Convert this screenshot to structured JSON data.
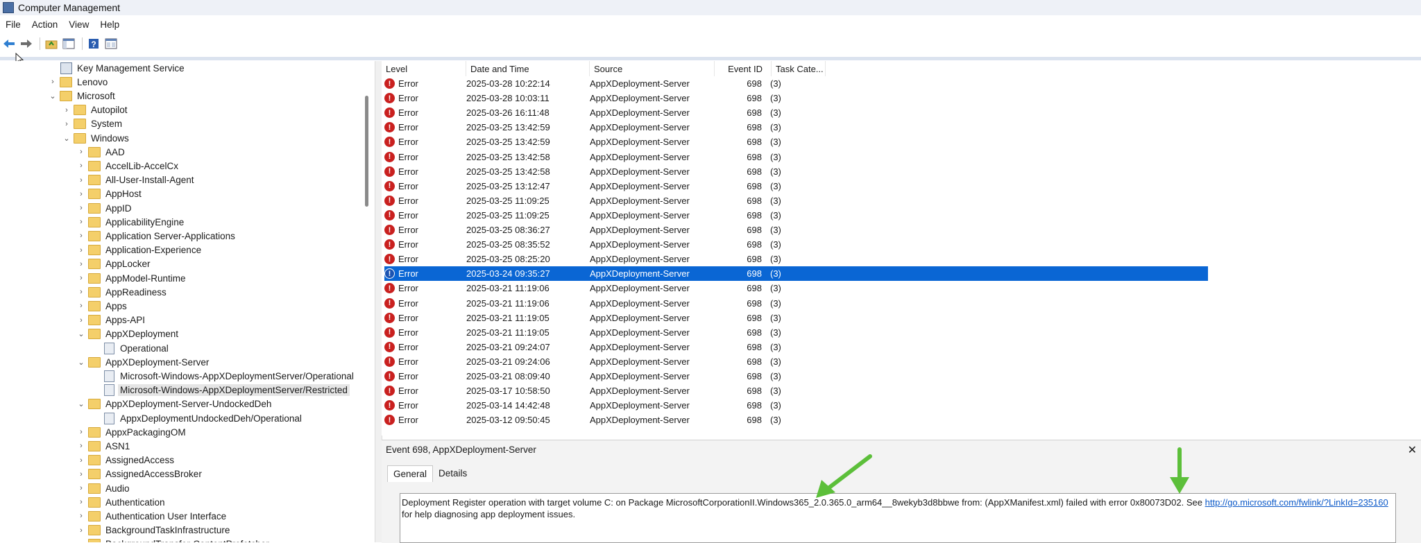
{
  "window": {
    "title": "Computer Management"
  },
  "menu": [
    "File",
    "Action",
    "View",
    "Help"
  ],
  "tree": {
    "items": [
      {
        "label": "Key Management Service",
        "depth": 0,
        "type": "key",
        "expander": ""
      },
      {
        "label": "Lenovo",
        "depth": 0,
        "type": "folder",
        "expander": "›"
      },
      {
        "label": "Microsoft",
        "depth": 0,
        "type": "folder",
        "expander": "⌄"
      },
      {
        "label": "Autopilot",
        "depth": 1,
        "type": "folder",
        "expander": "›"
      },
      {
        "label": "System",
        "depth": 1,
        "type": "folder",
        "expander": "›"
      },
      {
        "label": "Windows",
        "depth": 1,
        "type": "folder",
        "expander": "⌄"
      },
      {
        "label": "AAD",
        "depth": 2,
        "type": "folder",
        "expander": "›"
      },
      {
        "label": "AccelLib-AccelCx",
        "depth": 2,
        "type": "folder",
        "expander": "›"
      },
      {
        "label": "All-User-Install-Agent",
        "depth": 2,
        "type": "folder",
        "expander": "›"
      },
      {
        "label": "AppHost",
        "depth": 2,
        "type": "folder",
        "expander": "›"
      },
      {
        "label": "AppID",
        "depth": 2,
        "type": "folder",
        "expander": "›"
      },
      {
        "label": "ApplicabilityEngine",
        "depth": 2,
        "type": "folder",
        "expander": "›"
      },
      {
        "label": "Application Server-Applications",
        "depth": 2,
        "type": "folder",
        "expander": "›"
      },
      {
        "label": "Application-Experience",
        "depth": 2,
        "type": "folder",
        "expander": "›"
      },
      {
        "label": "AppLocker",
        "depth": 2,
        "type": "folder",
        "expander": "›"
      },
      {
        "label": "AppModel-Runtime",
        "depth": 2,
        "type": "folder",
        "expander": "›"
      },
      {
        "label": "AppReadiness",
        "depth": 2,
        "type": "folder",
        "expander": "›"
      },
      {
        "label": "Apps",
        "depth": 2,
        "type": "folder",
        "expander": "›"
      },
      {
        "label": "Apps-API",
        "depth": 2,
        "type": "folder",
        "expander": "›"
      },
      {
        "label": "AppXDeployment",
        "depth": 2,
        "type": "folder",
        "expander": "⌄"
      },
      {
        "label": "Operational",
        "depth": 3,
        "type": "log",
        "expander": ""
      },
      {
        "label": "AppXDeployment-Server",
        "depth": 2,
        "type": "folder",
        "expander": "⌄"
      },
      {
        "label": "Microsoft-Windows-AppXDeploymentServer/Operational",
        "depth": 3,
        "type": "log",
        "expander": ""
      },
      {
        "label": "Microsoft-Windows-AppXDeploymentServer/Restricted",
        "depth": 3,
        "type": "log",
        "expander": "",
        "selected": true
      },
      {
        "label": "AppXDeployment-Server-UndockedDeh",
        "depth": 2,
        "type": "folder",
        "expander": "⌄"
      },
      {
        "label": "AppxDeploymentUndockedDeh/Operational",
        "depth": 3,
        "type": "log",
        "expander": ""
      },
      {
        "label": "AppxPackagingOM",
        "depth": 2,
        "type": "folder",
        "expander": "›"
      },
      {
        "label": "ASN1",
        "depth": 2,
        "type": "folder",
        "expander": "›"
      },
      {
        "label": "AssignedAccess",
        "depth": 2,
        "type": "folder",
        "expander": "›"
      },
      {
        "label": "AssignedAccessBroker",
        "depth": 2,
        "type": "folder",
        "expander": "›"
      },
      {
        "label": "Audio",
        "depth": 2,
        "type": "folder",
        "expander": "›"
      },
      {
        "label": "Authentication",
        "depth": 2,
        "type": "folder",
        "expander": "›"
      },
      {
        "label": "Authentication User Interface",
        "depth": 2,
        "type": "folder",
        "expander": "›"
      },
      {
        "label": "BackgroundTaskInfrastructure",
        "depth": 2,
        "type": "folder",
        "expander": "›"
      },
      {
        "label": "BackgroundTransfer-ContentPrefetcher",
        "depth": 2,
        "type": "folder",
        "expander": "›"
      }
    ]
  },
  "events": {
    "columns": [
      "Level",
      "Date and Time",
      "Source",
      "Event ID",
      "Task Cate..."
    ],
    "rows": [
      {
        "level": "Error",
        "datetime": "2025-03-28 10:22:14",
        "source": "AppXDeployment-Server",
        "id": "698",
        "task": "(3)"
      },
      {
        "level": "Error",
        "datetime": "2025-03-28 10:03:11",
        "source": "AppXDeployment-Server",
        "id": "698",
        "task": "(3)"
      },
      {
        "level": "Error",
        "datetime": "2025-03-26 16:11:48",
        "source": "AppXDeployment-Server",
        "id": "698",
        "task": "(3)"
      },
      {
        "level": "Error",
        "datetime": "2025-03-25 13:42:59",
        "source": "AppXDeployment-Server",
        "id": "698",
        "task": "(3)"
      },
      {
        "level": "Error",
        "datetime": "2025-03-25 13:42:59",
        "source": "AppXDeployment-Server",
        "id": "698",
        "task": "(3)"
      },
      {
        "level": "Error",
        "datetime": "2025-03-25 13:42:58",
        "source": "AppXDeployment-Server",
        "id": "698",
        "task": "(3)"
      },
      {
        "level": "Error",
        "datetime": "2025-03-25 13:42:58",
        "source": "AppXDeployment-Server",
        "id": "698",
        "task": "(3)"
      },
      {
        "level": "Error",
        "datetime": "2025-03-25 13:12:47",
        "source": "AppXDeployment-Server",
        "id": "698",
        "task": "(3)"
      },
      {
        "level": "Error",
        "datetime": "2025-03-25 11:09:25",
        "source": "AppXDeployment-Server",
        "id": "698",
        "task": "(3)"
      },
      {
        "level": "Error",
        "datetime": "2025-03-25 11:09:25",
        "source": "AppXDeployment-Server",
        "id": "698",
        "task": "(3)"
      },
      {
        "level": "Error",
        "datetime": "2025-03-25 08:36:27",
        "source": "AppXDeployment-Server",
        "id": "698",
        "task": "(3)"
      },
      {
        "level": "Error",
        "datetime": "2025-03-25 08:35:52",
        "source": "AppXDeployment-Server",
        "id": "698",
        "task": "(3)"
      },
      {
        "level": "Error",
        "datetime": "2025-03-25 08:25:20",
        "source": "AppXDeployment-Server",
        "id": "698",
        "task": "(3)"
      },
      {
        "level": "Error",
        "datetime": "2025-03-24 09:35:27",
        "source": "AppXDeployment-Server",
        "id": "698",
        "task": "(3)",
        "selected": true
      },
      {
        "level": "Error",
        "datetime": "2025-03-21 11:19:06",
        "source": "AppXDeployment-Server",
        "id": "698",
        "task": "(3)"
      },
      {
        "level": "Error",
        "datetime": "2025-03-21 11:19:06",
        "source": "AppXDeployment-Server",
        "id": "698",
        "task": "(3)"
      },
      {
        "level": "Error",
        "datetime": "2025-03-21 11:19:05",
        "source": "AppXDeployment-Server",
        "id": "698",
        "task": "(3)"
      },
      {
        "level": "Error",
        "datetime": "2025-03-21 11:19:05",
        "source": "AppXDeployment-Server",
        "id": "698",
        "task": "(3)"
      },
      {
        "level": "Error",
        "datetime": "2025-03-21 09:24:07",
        "source": "AppXDeployment-Server",
        "id": "698",
        "task": "(3)"
      },
      {
        "level": "Error",
        "datetime": "2025-03-21 09:24:06",
        "source": "AppXDeployment-Server",
        "id": "698",
        "task": "(3)"
      },
      {
        "level": "Error",
        "datetime": "2025-03-21 08:09:40",
        "source": "AppXDeployment-Server",
        "id": "698",
        "task": "(3)"
      },
      {
        "level": "Error",
        "datetime": "2025-03-17 10:58:50",
        "source": "AppXDeployment-Server",
        "id": "698",
        "task": "(3)"
      },
      {
        "level": "Error",
        "datetime": "2025-03-14 14:42:48",
        "source": "AppXDeployment-Server",
        "id": "698",
        "task": "(3)"
      },
      {
        "level": "Error",
        "datetime": "2025-03-12 09:50:45",
        "source": "AppXDeployment-Server",
        "id": "698",
        "task": "(3)"
      }
    ]
  },
  "detail": {
    "title": "Event 698, AppXDeployment-Server",
    "close": "✕",
    "tabs": [
      "General",
      "Details"
    ],
    "message_prefix": "Deployment Register operation with target volume C: on Package MicrosoftCorporationII.Windows365_2.0.365.0_arm64__8wekyb3d8bbwe from:  (AppXManifest.xml)  failed with error 0x80073D02. See ",
    "link_text": "http://go.microsoft.com/fwlink/?LinkId=235160",
    "message_suffix": " for help diagnosing app deployment issues."
  },
  "colors": {
    "selection": "#0a66d4",
    "error": "#c9201f",
    "annotation_arrow": "#5cbf3a"
  },
  "icons": [
    "back-arrow-icon",
    "forward-arrow-icon",
    "up-folder-icon",
    "show-hide-tree-icon",
    "help-icon",
    "properties-icon"
  ]
}
